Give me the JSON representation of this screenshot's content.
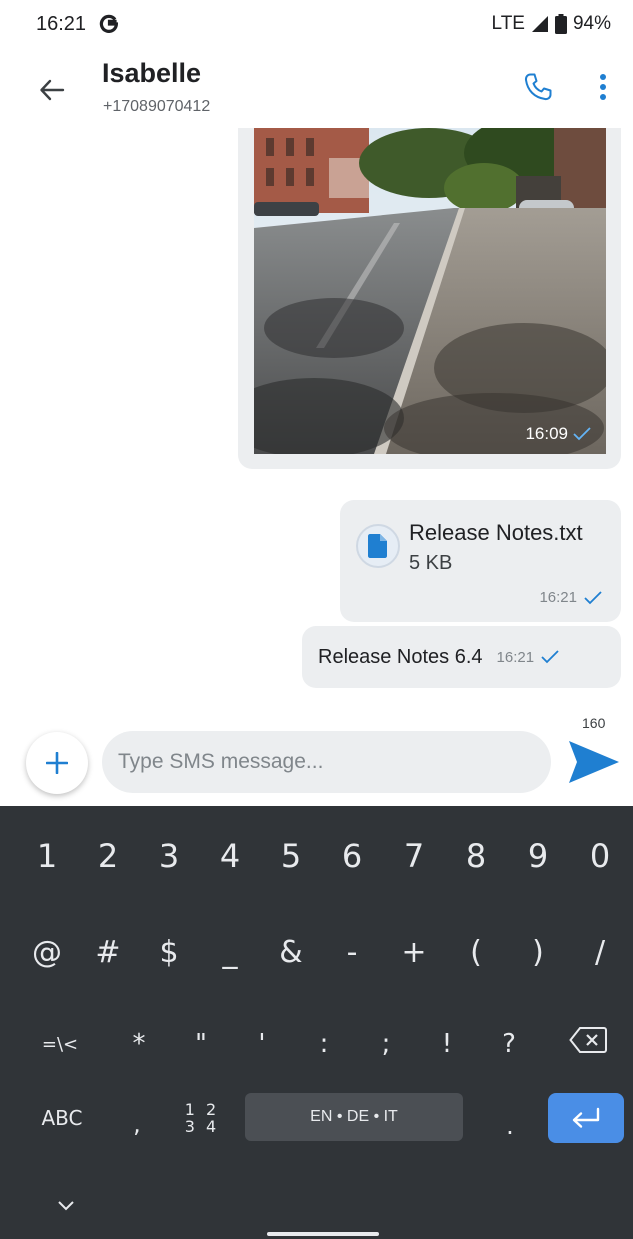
{
  "status_bar": {
    "time": "16:21",
    "network": "LTE",
    "battery": "94%",
    "icons": [
      "g-icon",
      "signal-icon",
      "battery-icon"
    ]
  },
  "header": {
    "contact_name": "Isabelle",
    "contact_number": "+17089070412",
    "icons": [
      "back-arrow-icon",
      "phone-icon",
      "more-vert-icon"
    ]
  },
  "messages": [
    {
      "type": "image",
      "time": "16:09",
      "status": "sent"
    },
    {
      "type": "file",
      "file_name": "Release Notes.txt",
      "file_size": "5 KB",
      "time": "16:21",
      "status": "sent"
    },
    {
      "type": "text",
      "text": "Release Notes 6.4",
      "time": "16:21",
      "status": "sent"
    }
  ],
  "composer": {
    "char_count": "160",
    "placeholder": "Type SMS message...",
    "value": ""
  },
  "keyboard": {
    "number_row": [
      "1",
      "2",
      "3",
      "4",
      "5",
      "6",
      "7",
      "8",
      "9",
      "0"
    ],
    "symbol_row_1": [
      "@",
      "#",
      "$",
      "_",
      "&",
      "-",
      "+",
      "(",
      ")",
      "/"
    ],
    "symbol_row_2": [
      "=\\<",
      "*",
      "\"",
      "'",
      ":",
      ";",
      "!",
      "?"
    ],
    "abc_label": "ABC",
    "comma": ",",
    "numpad_top": "1 2",
    "numpad_bottom": "3 4",
    "space_label": "EN • DE • IT",
    "period": "."
  },
  "colors": {
    "accent": "#1f7fd1",
    "bubble": "#eceef0",
    "keyboard_bg": "#303438",
    "enter_key": "#4a8ee6"
  }
}
